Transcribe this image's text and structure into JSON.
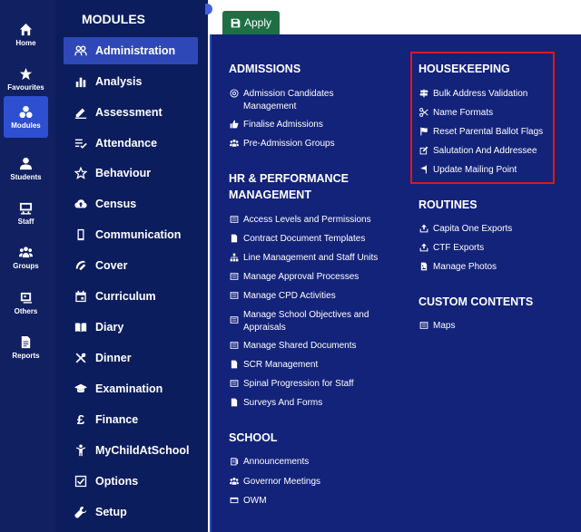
{
  "rail": [
    {
      "label": "Home",
      "icon": "home-icon",
      "active": false
    },
    {
      "label": "Favourites",
      "icon": "star-icon",
      "active": false
    },
    {
      "label": "Modules",
      "icon": "modules-icon",
      "active": true
    },
    {
      "label": "Students",
      "icon": "person-icon",
      "active": false
    },
    {
      "label": "Staff",
      "icon": "staff-icon",
      "active": false
    },
    {
      "label": "Groups",
      "icon": "groups-icon",
      "active": false
    },
    {
      "label": "Others",
      "icon": "others-icon",
      "active": false
    },
    {
      "label": "Reports",
      "icon": "reports-icon",
      "active": false
    }
  ],
  "modules": {
    "title": "MODULES",
    "items": [
      {
        "label": "Administration",
        "icon": "people-icon"
      },
      {
        "label": "Analysis",
        "icon": "bar-chart-icon"
      },
      {
        "label": "Assessment",
        "icon": "pencil-icon"
      },
      {
        "label": "Attendance",
        "icon": "checklist-icon"
      },
      {
        "label": "Behaviour",
        "icon": "star-outline-icon"
      },
      {
        "label": "Census",
        "icon": "cloud-upload-icon"
      },
      {
        "label": "Communication",
        "icon": "phone-icon"
      },
      {
        "label": "Cover",
        "icon": "cover-icon"
      },
      {
        "label": "Curriculum",
        "icon": "calendar-icon"
      },
      {
        "label": "Diary",
        "icon": "book-icon"
      },
      {
        "label": "Dinner",
        "icon": "cutlery-icon"
      },
      {
        "label": "Examination",
        "icon": "graduation-cap-icon"
      },
      {
        "label": "Finance",
        "icon": "pound-icon"
      },
      {
        "label": "MyChildAtSchool",
        "icon": "child-icon"
      },
      {
        "label": "Options",
        "icon": "checkbox-icon"
      },
      {
        "label": "Setup",
        "icon": "wrench-icon"
      }
    ]
  },
  "apply_label": "Apply",
  "sections": {
    "admissions": {
      "title": "ADMISSIONS",
      "links": [
        "Admission Candidates Management",
        "Finalise Admissions",
        "Pre-Admission Groups"
      ]
    },
    "hr": {
      "title": "HR & PERFORMANCE MANAGEMENT",
      "links": [
        "Access Levels and Permissions",
        "Contract Document Templates",
        "Line Management and Staff Units",
        "Manage Approval Processes",
        "Manage CPD Activities",
        "Manage School Objectives and Appraisals",
        "Manage Shared Documents",
        "SCR Management",
        "Spinal Progression for Staff",
        "Surveys And Forms"
      ]
    },
    "school": {
      "title": "SCHOOL",
      "links": [
        "Announcements",
        "Governor Meetings",
        "OWM"
      ]
    },
    "housekeeping": {
      "title": "HOUSEKEEPING",
      "links": [
        "Bulk Address Validation",
        "Name Formats",
        "Reset Parental Ballot Flags",
        "Salutation And Addressee",
        "Update Mailing Point"
      ]
    },
    "routines": {
      "title": "ROUTINES",
      "links": [
        "Capita One Exports",
        "CTF Exports",
        "Manage Photos"
      ]
    },
    "custom": {
      "title": "CUSTOM CONTENTS",
      "links": [
        "Maps"
      ]
    }
  },
  "colors": {
    "highlight": "#e3151b",
    "apply": "#1f6f45",
    "panel": "#13237a"
  }
}
